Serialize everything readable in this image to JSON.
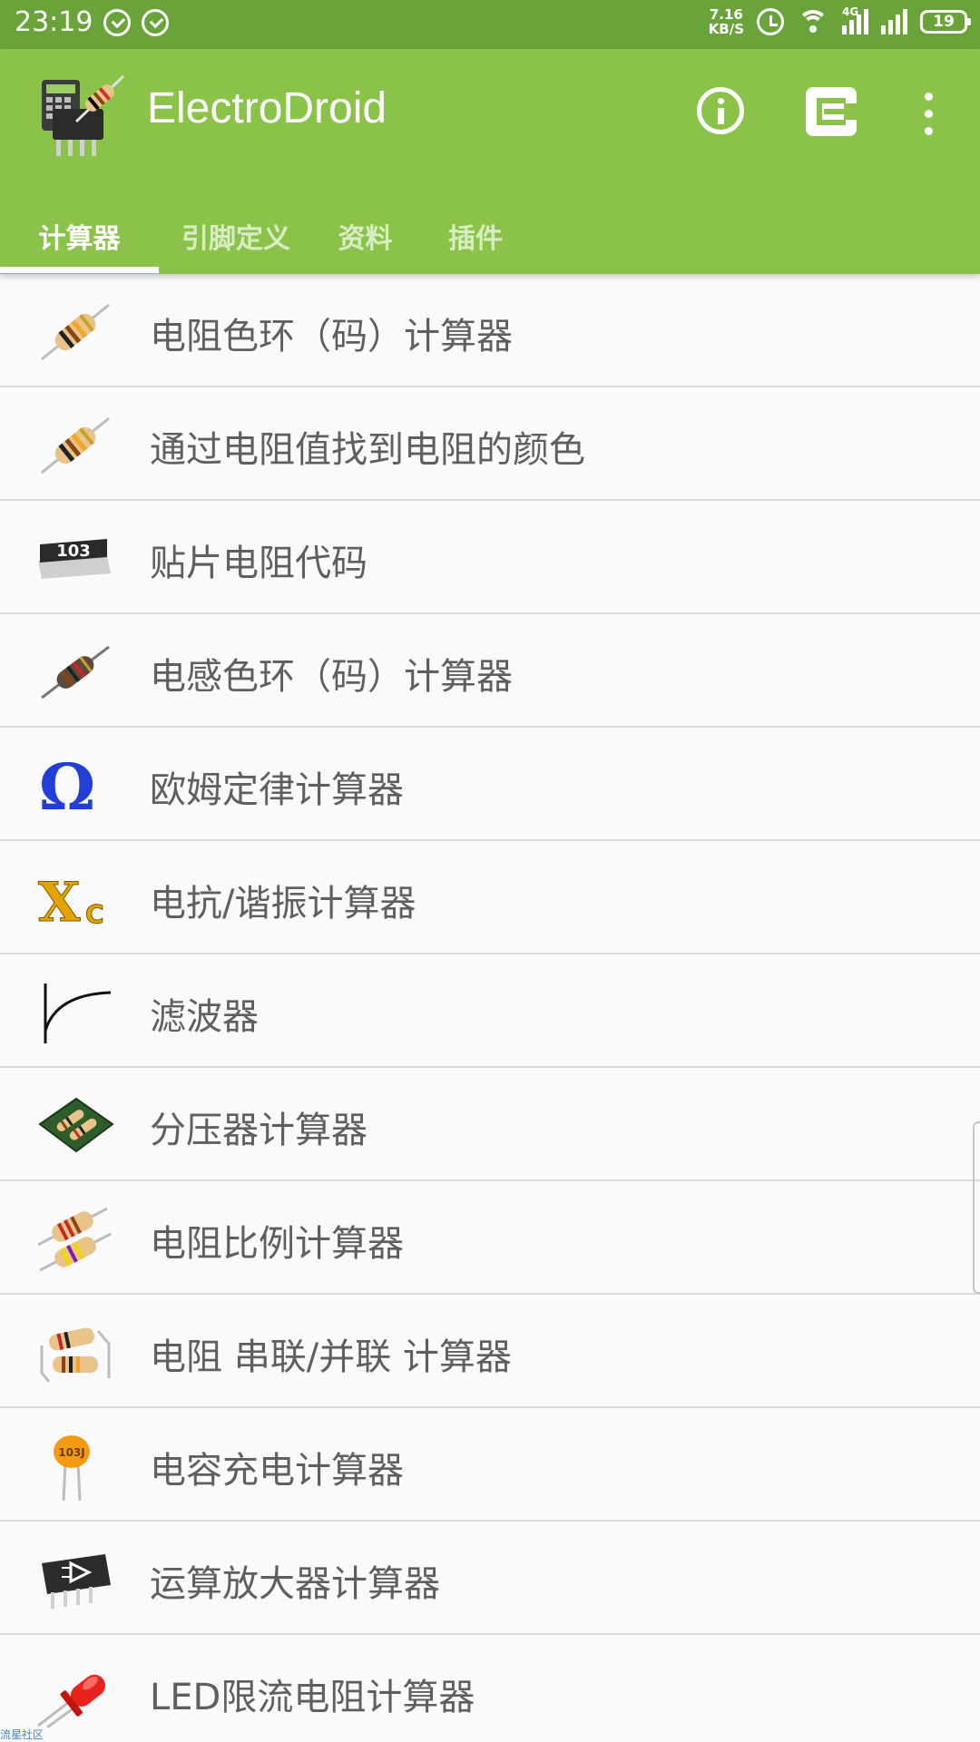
{
  "status_bar": {
    "time": "23:19",
    "net_speed_value": "7.16",
    "net_speed_unit": "KB/S",
    "signal_label": "4G",
    "battery": "19"
  },
  "app_bar": {
    "title": "ElectroDroid",
    "color": "#8bc34a"
  },
  "tabs": [
    {
      "label": "计算器",
      "active": true
    },
    {
      "label": "引脚定义",
      "active": false
    },
    {
      "label": "资料",
      "active": false
    },
    {
      "label": "插件",
      "active": false
    }
  ],
  "list": {
    "items": [
      {
        "label": "电阻色环（码）计算器",
        "icon": "resistor-icon"
      },
      {
        "label": "通过电阻值找到电阻的颜色",
        "icon": "resistor-icon"
      },
      {
        "label": "贴片电阻代码",
        "icon": "smd-resistor-icon",
        "icon_text": "103"
      },
      {
        "label": "电感色环（码）计算器",
        "icon": "inductor-icon"
      },
      {
        "label": "欧姆定律计算器",
        "icon": "omega-icon",
        "icon_text": "Ω"
      },
      {
        "label": "电抗/谐振计算器",
        "icon": "reactance-icon",
        "icon_text": "X",
        "icon_subtext": "C"
      },
      {
        "label": "滤波器",
        "icon": "filter-curve-icon"
      },
      {
        "label": "分压器计算器",
        "icon": "voltage-divider-pcb-icon"
      },
      {
        "label": "电阻比例计算器",
        "icon": "resistor-pair-icon"
      },
      {
        "label": "电阻 串联/并联 计算器",
        "icon": "series-parallel-icon"
      },
      {
        "label": "电容充电计算器",
        "icon": "capacitor-icon",
        "icon_text": "103J"
      },
      {
        "label": "运算放大器计算器",
        "icon": "opamp-chip-icon"
      },
      {
        "label": "LED限流电阻计算器",
        "icon": "led-icon"
      }
    ]
  },
  "watermark": "流星社区"
}
